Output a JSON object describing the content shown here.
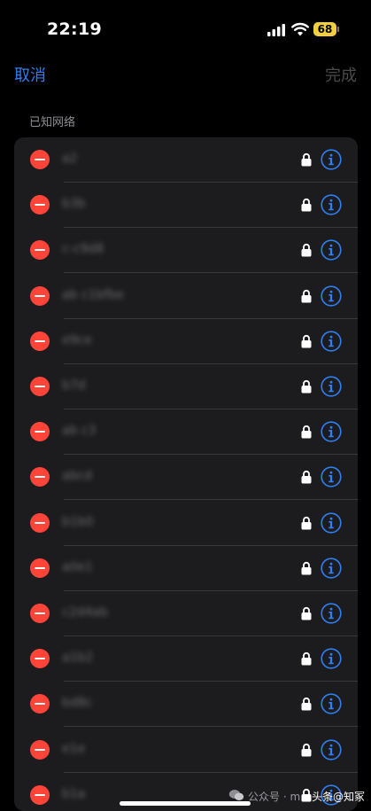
{
  "status_bar": {
    "time": "22:19",
    "battery": "68"
  },
  "nav": {
    "cancel_label": "取消",
    "done_label": "完成"
  },
  "section_header": "已知网络",
  "networks": [
    {
      "name": "a2"
    },
    {
      "name": "b3b"
    },
    {
      "name": "c-c9d8"
    },
    {
      "name": "ab c1bfbe"
    },
    {
      "name": "e9ce"
    },
    {
      "name": "b7d"
    },
    {
      "name": "ab c3"
    },
    {
      "name": "abcd"
    },
    {
      "name": "b1b0"
    },
    {
      "name": "a0e1"
    },
    {
      "name": "c2d4ab"
    },
    {
      "name": "a1b2"
    },
    {
      "name": "bd8c"
    },
    {
      "name": "e1e"
    },
    {
      "name": "b1a"
    }
  ],
  "watermark": {
    "left_text": "公众号 · m",
    "brand_text": "头条@知冢"
  },
  "colors": {
    "accent": "#2f7ff5",
    "delete": "#ff453a",
    "battery": "#f2cf3f"
  },
  "icons": {
    "delete": "minus-circle-icon",
    "lock": "lock-icon",
    "info": "info-circle-icon"
  }
}
